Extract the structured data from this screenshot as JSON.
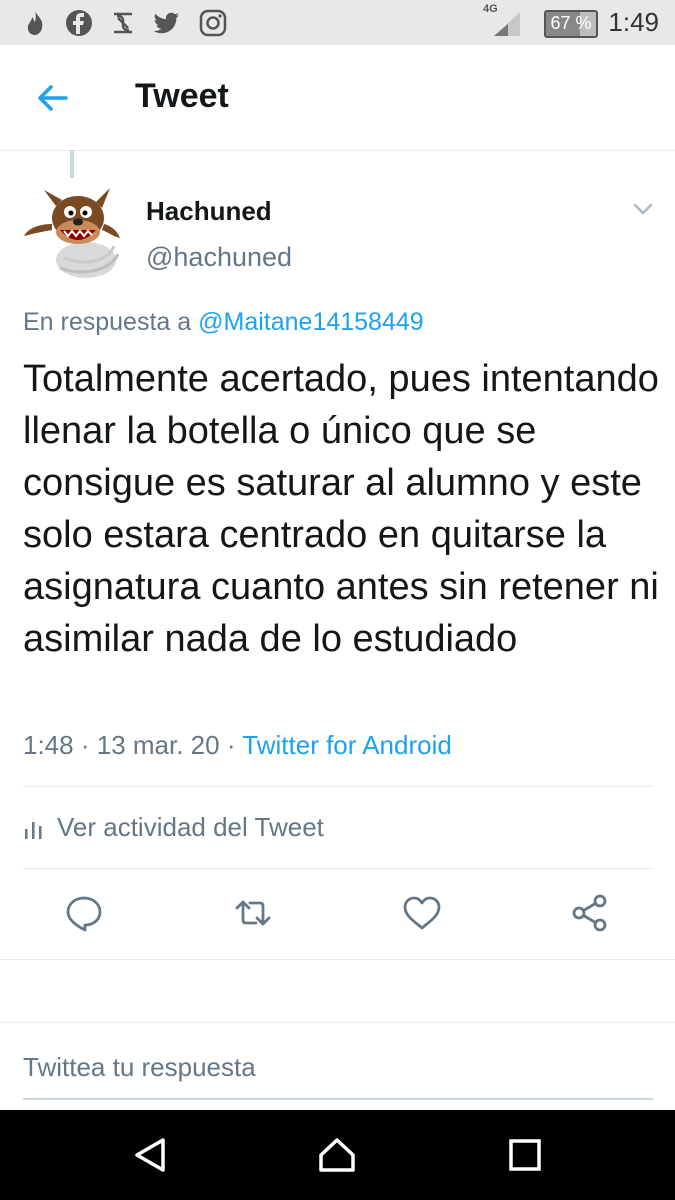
{
  "status_bar": {
    "signal_label": "4G",
    "battery_percent": 67,
    "battery_label": "67 %",
    "time": "1:49",
    "notification_icons": [
      "tinder-flame-icon",
      "facebook-icon",
      "squarespace-icon",
      "twitter-bird-icon",
      "instagram-icon"
    ]
  },
  "header": {
    "title": "Tweet"
  },
  "tweet": {
    "display_name": "Hachuned",
    "handle": "@hachuned",
    "reply_prefix": "En respuesta a",
    "reply_mention": "@Maitane14158449",
    "text": "Totalmente acertado, pues intentando llenar la botella o único que se consigue es saturar al alumno y este solo estara centrado en quitarse la asignatura cuanto antes sin retener ni asimilar nada de lo estudiado",
    "time": "1:48",
    "date": "13 mar. 20",
    "separator": "·",
    "source": "Twitter for Android"
  },
  "activity": {
    "label": "Ver actividad del Tweet"
  },
  "compose": {
    "placeholder": "Twittea tu respuesta"
  },
  "colors": {
    "accent": "#1da1f2",
    "secondary_text": "#657786",
    "divider": "#e6ecf0"
  }
}
